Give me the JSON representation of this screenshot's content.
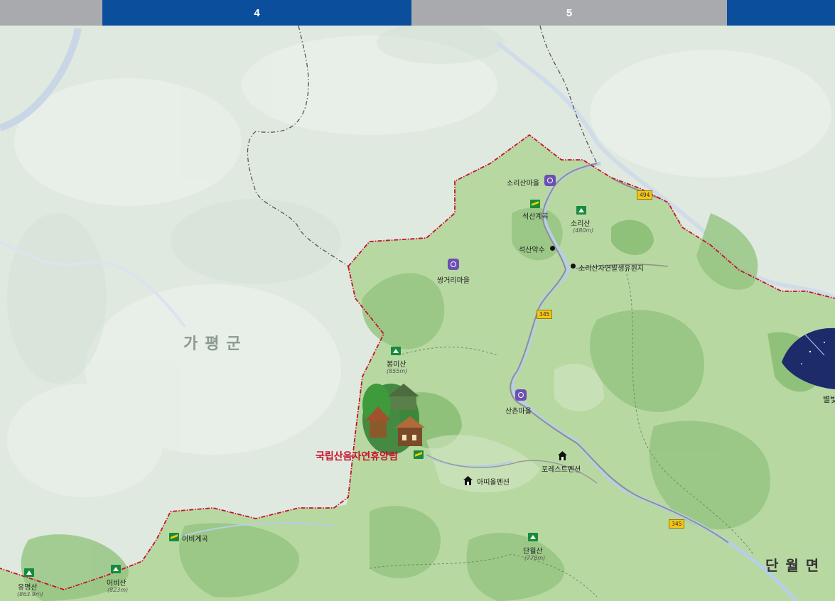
{
  "header": {
    "page_left_label": "4",
    "page_right_label": "5"
  },
  "colors": {
    "bar_gray": "#a9aaae",
    "bar_blue": "#0b4f9c",
    "boundary_red": "#c8102e",
    "forest_green": "#8fc57a"
  },
  "regions": {
    "gapyeong": "가평군",
    "danwol": "단월면"
  },
  "feature": {
    "name": "국립산음자연휴양림"
  },
  "peaks": [
    {
      "name": "소리산",
      "elevation": "(480m)"
    },
    {
      "name": "봉미산",
      "elevation": "(855m)"
    },
    {
      "name": "단월산",
      "elevation": "(778m)"
    },
    {
      "name": "유명산",
      "elevation": "(863.9m)"
    },
    {
      "name": "어비산",
      "elevation": "(823m)"
    }
  ],
  "villages": [
    {
      "name": "소리산마을"
    },
    {
      "name": "쌍거리마을"
    },
    {
      "name": "산촌마을"
    }
  ],
  "valleys": [
    {
      "name": "석산계곡"
    },
    {
      "name": "어비계곡"
    }
  ],
  "points": [
    {
      "name": "석산약수"
    },
    {
      "name": "소리산자연발생유원지"
    }
  ],
  "lodgings": [
    {
      "name": "포레스트펜션"
    },
    {
      "name": "아띠올펜션"
    }
  ],
  "roads": [
    {
      "number": "494"
    },
    {
      "number": "345"
    },
    {
      "number": "345"
    }
  ],
  "inset_partial_label": "별빛"
}
